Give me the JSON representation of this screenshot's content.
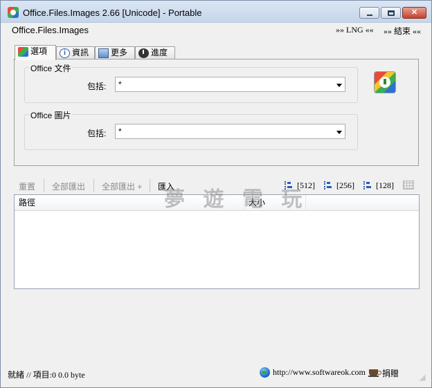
{
  "window": {
    "title": "Office.Files.Images 2.66 [Unicode] - Portable",
    "min_label": "",
    "max_label": "",
    "close_label": "✕"
  },
  "menu": {
    "app_name": "Office.Files.Images",
    "lng": "»» LNG ««",
    "exit": "»» 結束 ««"
  },
  "tabs": [
    {
      "label": "選項",
      "icon": "options-icon"
    },
    {
      "label": "資訊",
      "icon": "info-icon"
    },
    {
      "label": "更多",
      "icon": "monitor-icon"
    },
    {
      "label": "進度",
      "icon": "clock-icon"
    }
  ],
  "groups": {
    "office_docs": {
      "title": "Office 文件",
      "include_label": "包括:",
      "value": "*"
    },
    "office_images": {
      "title": "Office 圖片",
      "include_label": "包括:",
      "value": "*"
    }
  },
  "toolbar": {
    "reset": "重置",
    "export_all": "全部匯出",
    "export_all_plus": "全部匯出 +",
    "import": "匯入",
    "size_512": "[512]",
    "size_256": "[256]",
    "size_128": "[128]"
  },
  "watermark": "夢 遊 電 玩",
  "list": {
    "columns": [
      "路徑",
      "大小",
      ""
    ]
  },
  "status": {
    "text": "就緒 // 項目:0 0.0 byte",
    "url": "http://www.softwareok.com",
    "donate": "捐贈"
  }
}
